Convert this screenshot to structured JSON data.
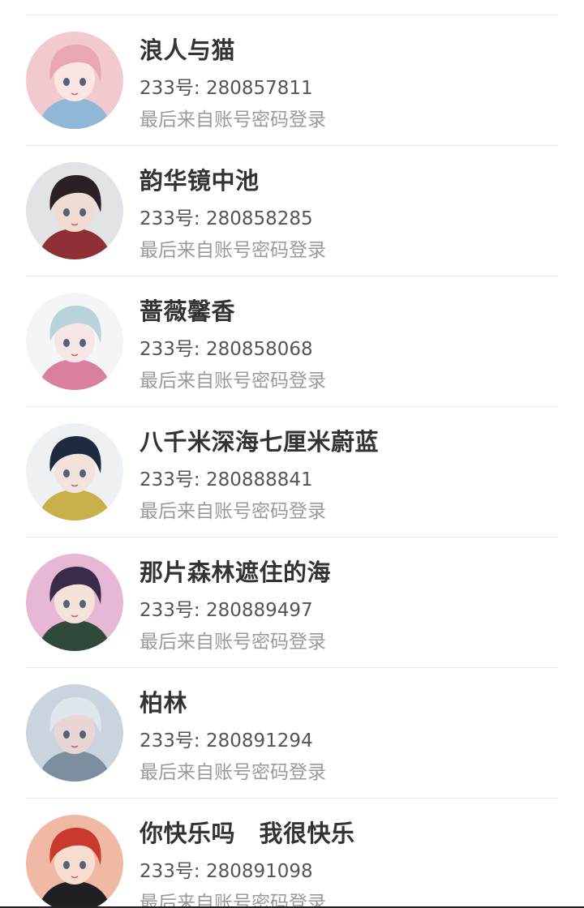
{
  "accounts": [
    {
      "name": "浪人与猫",
      "uid_prefix": "233号: ",
      "uid": "280857811",
      "login_note": "最后来自账号密码登录",
      "avatar": {
        "icon": "anime-avatar-pink-hair",
        "bg": "#f3c9d0",
        "hair": "#e9a6b3",
        "skin": "#fbe6e3",
        "accent": "#8fb7d6"
      }
    },
    {
      "name": "韵华镜中池",
      "uid_prefix": "233号: ",
      "uid": "280858285",
      "login_note": "最后来自账号密码登录",
      "avatar": {
        "icon": "anime-avatar-dark-hair-red-coat",
        "bg": "#e2e3e6",
        "hair": "#2a2025",
        "skin": "#f1dcd4",
        "accent": "#8e2f35"
      }
    },
    {
      "name": "蔷薇馨香",
      "uid_prefix": "233号: ",
      "uid": "280858068",
      "login_note": "最后来自账号密码登录",
      "avatar": {
        "icon": "anime-avatar-light-blue-hair",
        "bg": "#f4f5f7",
        "hair": "#b9d3dd",
        "skin": "#f6e6e6",
        "accent": "#d97fa2"
      }
    },
    {
      "name": "八千米深海七厘米蔚蓝",
      "uid_prefix": "233号: ",
      "uid": "280888841",
      "login_note": "最后来自账号密码登录",
      "avatar": {
        "icon": "anime-avatar-navy-hair",
        "bg": "#eef1f4",
        "hair": "#1f2a3e",
        "skin": "#f3e3dc",
        "accent": "#c8b04a"
      }
    },
    {
      "name": "那片森林遮住的海",
      "uid_prefix": "233号: ",
      "uid": "280889497",
      "login_note": "最后来自账号密码登录",
      "avatar": {
        "icon": "anime-avatar-purple-hair",
        "bg": "#e7b7d6",
        "hair": "#3b2a4a",
        "skin": "#f5e2d9",
        "accent": "#2f4a3a"
      }
    },
    {
      "name": "柏林",
      "uid_prefix": "233号: ",
      "uid": "280891294",
      "login_note": "最后来自账号密码登录",
      "avatar": {
        "icon": "anime-avatar-silver-hair",
        "bg": "#c9d4de",
        "hair": "#dfe6ec",
        "skin": "#e9d6d4",
        "accent": "#7d8ea0"
      }
    },
    {
      "name": "你快乐吗　我很快乐",
      "uid_prefix": "233号: ",
      "uid": "280891098",
      "login_note": "最后来自账号密码登录",
      "avatar": {
        "icon": "anime-avatar-red-white-hair",
        "bg": "#f0b9a4",
        "hair": "#c9392e",
        "skin": "#f6ddd0",
        "accent": "#1f1f24"
      }
    }
  ]
}
